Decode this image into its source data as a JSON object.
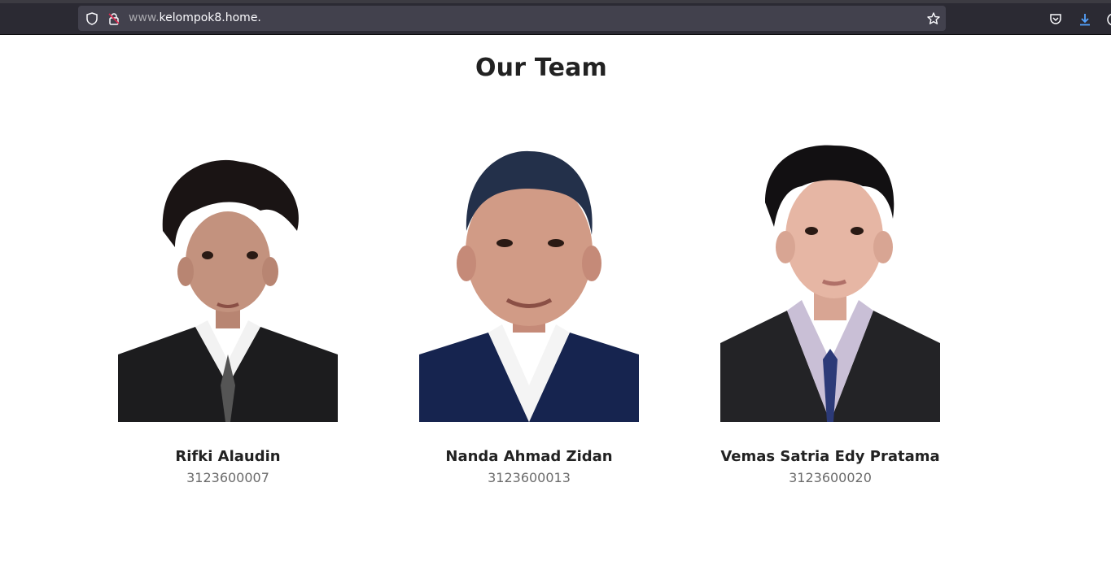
{
  "browser": {
    "url_prefix": "www.",
    "url_domain": "kelompok8.home.",
    "icons": [
      "shield-icon",
      "lock-icon",
      "star-icon",
      "pocket-icon",
      "download-icon",
      "account-icon"
    ]
  },
  "page": {
    "title": "Our Team",
    "members": [
      {
        "name": "Rifki Alaudin",
        "id": "3123600007",
        "suit_color": "#1c1c1e",
        "tie_color": "#555555"
      },
      {
        "name": "Nanda Ahmad Zidan",
        "id": "3123600013",
        "suit_color": "#16244f",
        "tie_color": "#ffffff"
      },
      {
        "name": "Vemas Satria Edy Pratama",
        "id": "3123600020",
        "suit_color": "#232326",
        "tie_color": "#2c3a78"
      }
    ]
  },
  "colors": {
    "toolbar_bg": "#2b2a33",
    "urlbar_bg": "#42414d",
    "title_text": "#222222",
    "id_text": "#6b6b6b"
  }
}
